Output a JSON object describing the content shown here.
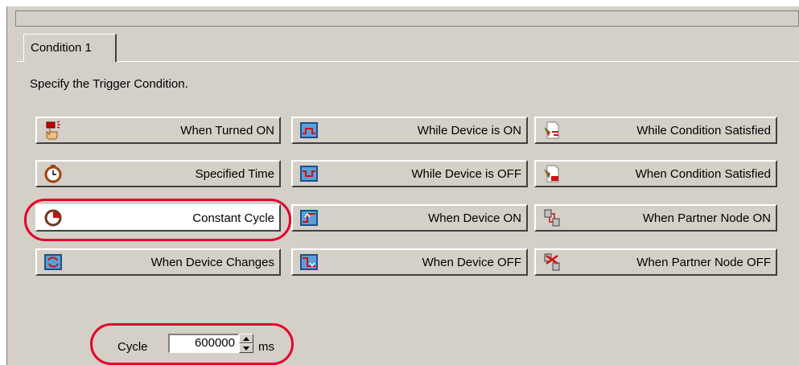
{
  "tab": {
    "label": "Condition 1"
  },
  "instruction": "Specify the Trigger Condition.",
  "buttons": {
    "when_turned_on": "When Turned ON",
    "while_device_on": "While Device is ON",
    "while_condition_satisfied": "While Condition Satisfied",
    "specified_time": "Specified Time",
    "while_device_off": "While Device is OFF",
    "when_condition_satisfied": "When Condition Satisfied",
    "constant_cycle": "Constant Cycle",
    "when_device_on": "When Device ON",
    "when_partner_node_on": "When Partner Node ON",
    "when_device_changes": "When Device Changes",
    "when_device_off": "When Device OFF",
    "when_partner_node_off": "When Partner Node OFF"
  },
  "selected_button": "constant_cycle",
  "cycle": {
    "label": "Cycle",
    "value": "600000",
    "unit": "ms"
  },
  "colors": {
    "highlight": "#e4002b",
    "face": "#d4d0c8"
  }
}
